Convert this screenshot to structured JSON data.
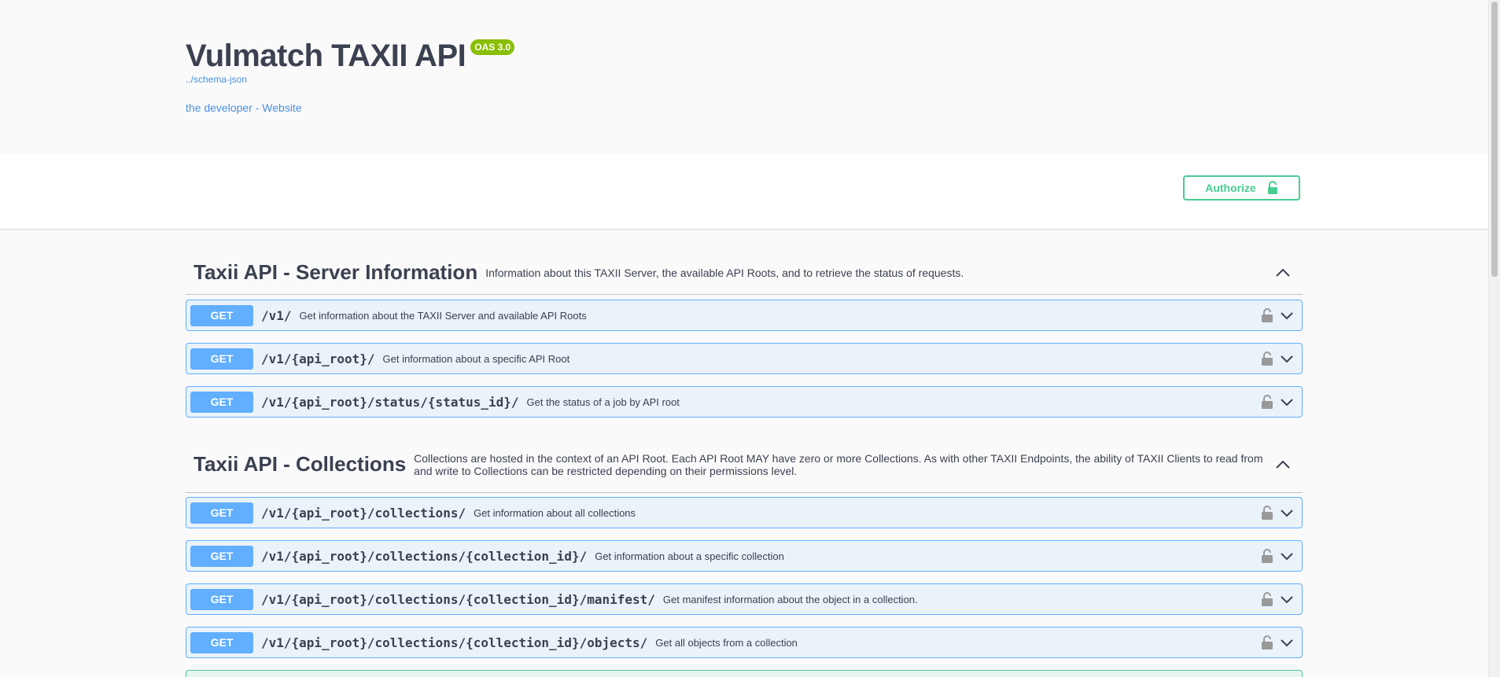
{
  "info": {
    "title": "Vulmatch TAXII API",
    "oas_badge": "OAS 3.0",
    "schema_link": "../schema-json",
    "website_link": "the developer - Website"
  },
  "auth": {
    "authorize_label": "Authorize"
  },
  "colors": {
    "get": "#61affe",
    "post": "#49cc90",
    "link": "#4990e2"
  },
  "sections": [
    {
      "name": "Taxii API - Server Information",
      "description": "Information about this TAXII Server, the available API Roots, and to retrieve the status of requests.",
      "operations": [
        {
          "method": "GET",
          "path": "/v1/",
          "summary": "Get information about the TAXII Server and available API Roots"
        },
        {
          "method": "GET",
          "path": "/v1/{api_root}/",
          "summary": "Get information about a specific API Root"
        },
        {
          "method": "GET",
          "path": "/v1/{api_root}/status/{status_id}/",
          "summary": "Get the status of a job by API root"
        }
      ]
    },
    {
      "name": "Taxii API - Collections",
      "description": "Collections are hosted in the context of an API Root. Each API Root MAY have zero or more Collections. As with other TAXII Endpoints, the ability of TAXII Clients to read from and write to Collections can be restricted depending on their permissions level.",
      "operations": [
        {
          "method": "GET",
          "path": "/v1/{api_root}/collections/",
          "summary": "Get information about all collections"
        },
        {
          "method": "GET",
          "path": "/v1/{api_root}/collections/{collection_id}/",
          "summary": "Get information about a specific collection"
        },
        {
          "method": "GET",
          "path": "/v1/{api_root}/collections/{collection_id}/manifest/",
          "summary": "Get manifest information about the object in a collection."
        },
        {
          "method": "GET",
          "path": "/v1/{api_root}/collections/{collection_id}/objects/",
          "summary": "Get all objects from a collection"
        }
      ]
    }
  ]
}
